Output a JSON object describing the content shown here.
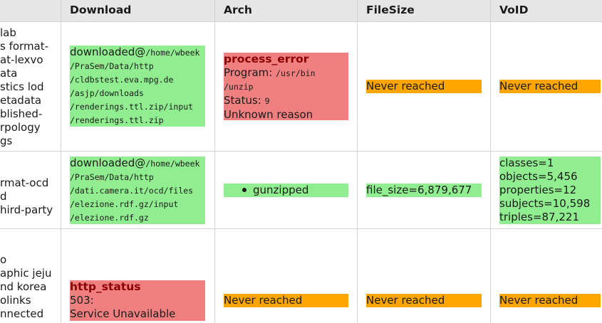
{
  "columns": [
    "Download",
    "Arch",
    "FileSize",
    "VoID"
  ],
  "rows": [
    {
      "left_lines": [
        "lab",
        "s format-",
        "at-lexvo",
        "ata",
        "stics lod",
        "etadata",
        "blished-",
        "rpology",
        "gs"
      ],
      "download": {
        "status": "ok",
        "prefix": "downloaded@",
        "path_lines": [
          "/home/wbeek",
          "/PraSem/Data/http",
          "/cldbstest.eva.mpg.de",
          "/asjp/downloads",
          "/renderings.ttl.zip/input",
          "/renderings.ttl.zip"
        ]
      },
      "arch": {
        "status": "err",
        "title": "process_error",
        "program_label": "Program: ",
        "program_lines": [
          "/usr/bin",
          "/unzip"
        ],
        "status_label": "Status: ",
        "status_value": "9",
        "reason": "Unknown reason"
      },
      "filesize": "Never reached",
      "void": "Never reached"
    },
    {
      "left_lines": [
        "rmat-ocd",
        "d",
        "hird-party"
      ],
      "download": {
        "status": "ok",
        "prefix": "downloaded@",
        "path_lines": [
          "/home/wbeek",
          "/PraSem/Data/http",
          "/dati.camera.it/ocd/files",
          "/elezione.rdf.gz/input",
          "/elezione.rdf.gz"
        ]
      },
      "arch": {
        "status": "ok",
        "bullet": "gunzipped"
      },
      "filesize": "file_size=6,879,677",
      "void_lines": [
        "classes=1",
        "objects=5,456",
        "properties=12",
        "subjects=10,598",
        "triples=87,221"
      ]
    },
    {
      "left_lines": [
        "o",
        "aphic jeju",
        "nd korea",
        "olinks",
        "nnected"
      ],
      "download": {
        "status": "err",
        "title": "http_status",
        "lines": [
          "503:",
          "Service Unavailable"
        ]
      },
      "arch": "Never reached",
      "filesize": "Never reached",
      "void": "Never reached"
    }
  ]
}
